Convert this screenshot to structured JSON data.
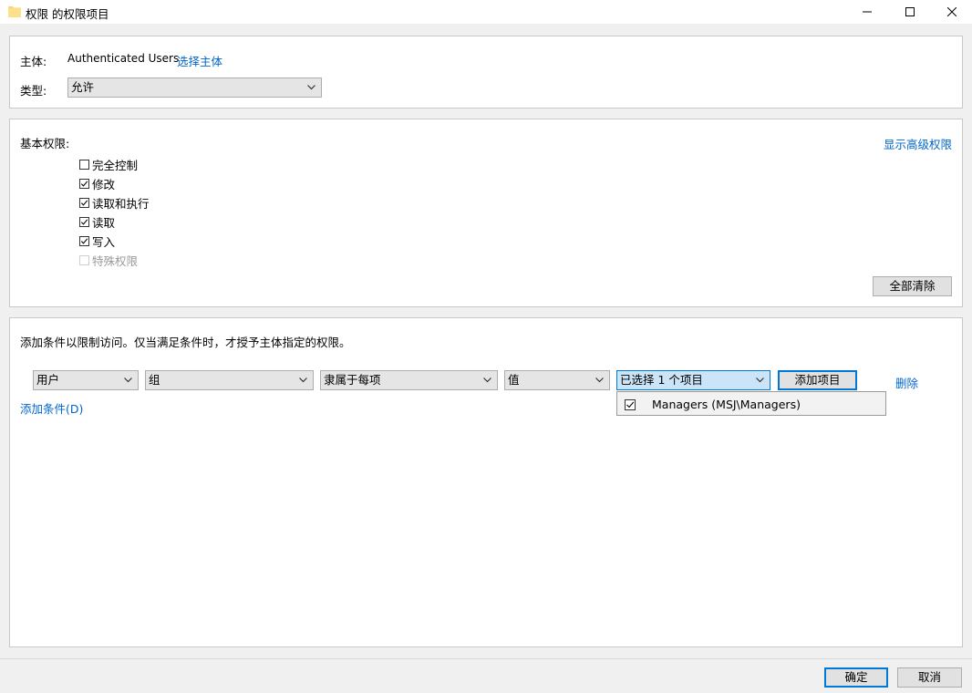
{
  "window": {
    "title": "权限 的权限项目"
  },
  "principal": {
    "label": "主体:",
    "value": "Authenticated Users",
    "select_link": "选择主体"
  },
  "type": {
    "label": "类型:",
    "selected": "允许"
  },
  "basic_permissions": {
    "label": "基本权限:",
    "show_advanced_link": "显示高级权限",
    "items": [
      {
        "label": "完全控制",
        "checked": false,
        "disabled": false
      },
      {
        "label": "修改",
        "checked": true,
        "disabled": false
      },
      {
        "label": "读取和执行",
        "checked": true,
        "disabled": false
      },
      {
        "label": "读取",
        "checked": true,
        "disabled": false
      },
      {
        "label": "写入",
        "checked": true,
        "disabled": false
      },
      {
        "label": "特殊权限",
        "checked": false,
        "disabled": true
      }
    ],
    "clear_all_button": "全部清除"
  },
  "conditions": {
    "description": "添加条件以限制访问。仅当满足条件时，才授予主体指定的权限。",
    "row": {
      "user": "用户",
      "group": "组",
      "operator": "隶属于每项",
      "value_type": "值",
      "selection": "已选择 1 个项目",
      "add_items_button": "添加项目",
      "delete_link": "删除"
    },
    "dropdown_items": [
      {
        "label": "Managers (MSJ\\Managers)",
        "checked": true
      }
    ],
    "add_condition_link": "添加条件(D)"
  },
  "footer": {
    "ok_button": "确定",
    "cancel_button": "取消"
  }
}
